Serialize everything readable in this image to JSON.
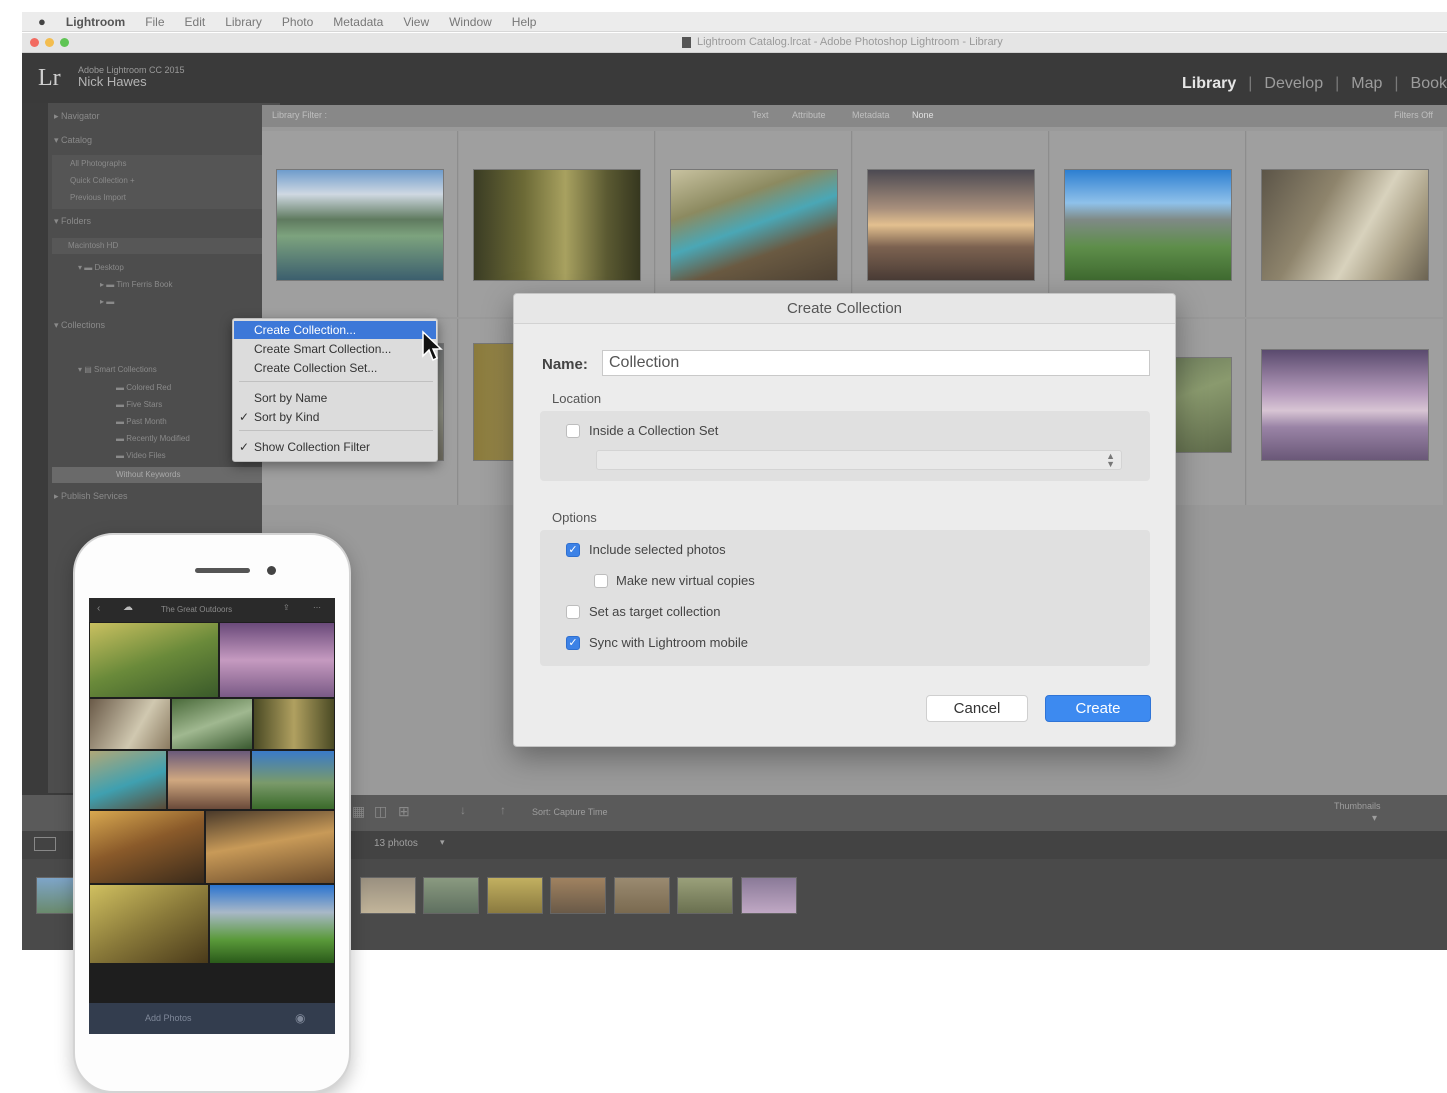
{
  "menubar": {
    "apple": "",
    "items": [
      "Lightroom",
      "File",
      "Edit",
      "Library",
      "Photo",
      "Metadata",
      "View",
      "Window",
      "Help"
    ]
  },
  "window": {
    "title": "Lightroom Catalog.lrcat - Adobe Photoshop Lightroom - Library"
  },
  "lightroom": {
    "logo": "Lr",
    "user_line": "Adobe Lightroom CC 2015",
    "user_name": "Nick Hawes",
    "modules": [
      {
        "label": "Library",
        "active": true
      },
      {
        "label": "Develop",
        "active": false
      },
      {
        "label": "Map",
        "active": false
      },
      {
        "label": "Book",
        "active": false
      }
    ]
  },
  "left_panel": {
    "sections": [
      "Navigator",
      "Catalog",
      "Folders",
      "Collections",
      "Publish Services"
    ],
    "catalog_items": [
      "All Photographs",
      "Quick Collection +",
      "Previous Import"
    ],
    "folder_items": [
      "Macintosh HD",
      "Desktop",
      "Tim Ferris Book"
    ],
    "collection_items": [
      "Smart Collections",
      "Colored Red",
      "Five Stars",
      "Past Month",
      "Recently Modified",
      "Video Files",
      "Without Keywords"
    ]
  },
  "grid_header": {
    "label": "Library Filter :",
    "tabs": [
      "Text",
      "Attribute",
      "Metadata",
      "None"
    ],
    "right": "Filters Off"
  },
  "toolbar": {
    "sort_label": "Sort: Capture Time",
    "thumbnails_label": "Thumbnails"
  },
  "filmstrip": {
    "source": "13 photos"
  },
  "context_menu": {
    "items": [
      {
        "label": "Create Collection...",
        "highlighted": true,
        "checked": false
      },
      {
        "label": "Create Smart Collection...",
        "highlighted": false,
        "checked": false
      },
      {
        "label": "Create Collection Set...",
        "highlighted": false,
        "checked": false
      },
      {
        "label": "Sort by Name",
        "highlighted": false,
        "checked": false
      },
      {
        "label": "Sort by Kind",
        "highlighted": false,
        "checked": true
      },
      {
        "label": "Show Collection Filter",
        "highlighted": false,
        "checked": true
      }
    ],
    "check_glyph": "✓"
  },
  "dialog": {
    "title": "Create Collection",
    "name_label": "Name:",
    "name_value": "Collection",
    "location_heading": "Location",
    "inside_set_label": "Inside a Collection Set",
    "inside_set_checked": false,
    "options_heading": "Options",
    "options": [
      {
        "label": "Include selected photos",
        "checked": true
      },
      {
        "label": "Make new virtual copies",
        "checked": false
      },
      {
        "label": "Set as target collection",
        "checked": false
      },
      {
        "label": "Sync with Lightroom mobile",
        "checked": true
      }
    ],
    "cancel_label": "Cancel",
    "create_label": "Create",
    "accent": "#3d8af0"
  },
  "phone": {
    "collection_title": "The Great Outdoors",
    "bottom_label": "Add Photos"
  }
}
